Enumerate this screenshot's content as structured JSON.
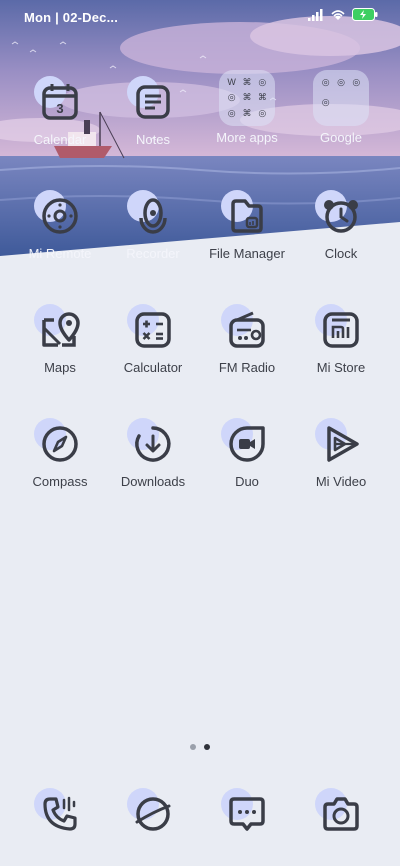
{
  "status_bar": {
    "time": "Mon | 02-Dec...",
    "signal_icon": "signal-bars-icon",
    "wifi_icon": "wifi-icon",
    "battery_icon": "battery-charging-icon"
  },
  "rows": [
    [
      {
        "label": "Calendar",
        "icon": "calendar-icon",
        "day": "3"
      },
      {
        "label": "Notes",
        "icon": "notes-icon"
      },
      {
        "label": "More apps",
        "icon": "folder-icon"
      },
      {
        "label": "Google",
        "icon": "folder-icon"
      }
    ],
    [
      {
        "label": "Mi Remote",
        "icon": "remote-icon"
      },
      {
        "label": "Recorder",
        "icon": "recorder-icon"
      },
      {
        "label": "File Manager",
        "icon": "file-manager-icon"
      },
      {
        "label": "Clock",
        "icon": "clock-icon"
      }
    ],
    [
      {
        "label": "Maps",
        "icon": "maps-icon"
      },
      {
        "label": "Calculator",
        "icon": "calculator-icon"
      },
      {
        "label": "FM Radio",
        "icon": "radio-icon"
      },
      {
        "label": "Mi Store",
        "icon": "mi-store-icon"
      }
    ],
    [
      {
        "label": "Compass",
        "icon": "compass-icon"
      },
      {
        "label": "Downloads",
        "icon": "downloads-icon"
      },
      {
        "label": "Duo",
        "icon": "duo-icon"
      },
      {
        "label": "Mi Video",
        "icon": "mi-video-icon"
      }
    ]
  ],
  "page_indicator": {
    "pages": 2,
    "active": 2
  },
  "dock": [
    {
      "icon": "phone-icon"
    },
    {
      "icon": "browser-icon"
    },
    {
      "icon": "messages-icon"
    },
    {
      "icon": "camera-icon"
    }
  ],
  "colors": {
    "accent_blob": "#cfd6fa",
    "icon_stroke": "#3a3d47",
    "background": "#e9ecf3"
  }
}
